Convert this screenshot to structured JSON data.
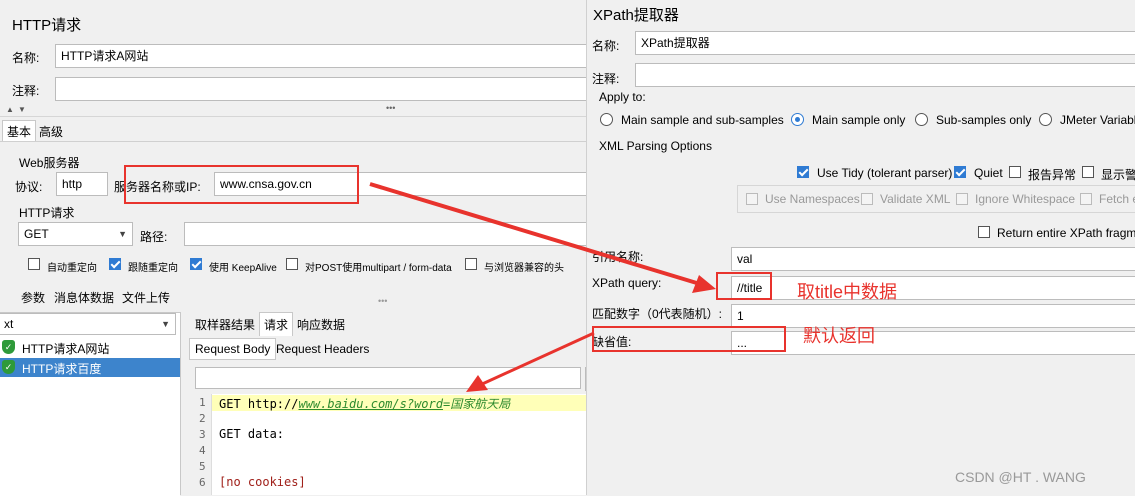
{
  "left": {
    "title": "HTTP请求",
    "name_label": "名称:",
    "name_value": "HTTP请求A网站",
    "comment_label": "注释:",
    "tabs": [
      "基本",
      "高级"
    ],
    "web_server_label": "Web服务器",
    "protocol_label": "协议:",
    "protocol_value": "http",
    "server_label": "服务器名称或IP:",
    "server_value": "www.cnsa.gov.cn",
    "http_request_label": "HTTP请求",
    "method_value": "GET",
    "path_label": "路径:",
    "options": [
      {
        "label": "自动重定向",
        "checked": false
      },
      {
        "label": "跟随重定向",
        "checked": true
      },
      {
        "label": "使用 KeepAlive",
        "checked": true
      },
      {
        "label": "对POST使用multipart / form-data",
        "checked": false
      },
      {
        "label": "与浏览器兼容的头",
        "checked": false
      }
    ],
    "sub_tabs": [
      "参数",
      "消息体数据",
      "文件上传"
    ]
  },
  "results": {
    "dropdown_value": "xt",
    "tree_items": [
      "HTTP请求A网站",
      "HTTP请求百度"
    ],
    "tabs": [
      "取样器结果",
      "请求",
      "响应数据"
    ],
    "sub_tabs": [
      "Request Body",
      "Request Headers"
    ],
    "lines": [
      {
        "no": "1",
        "text": "GET http://www.baidu.com/s?word=国家航天局"
      },
      {
        "no": "3",
        "text": "GET data:"
      },
      {
        "no": "6",
        "text": "[no cookies]"
      }
    ],
    "line_prefix": "GET http://",
    "line_url": "www.baidu.com/s?word",
    "line_suffix": "=国家航天局",
    "line_numbers": [
      "1",
      "2",
      "3",
      "4",
      "5",
      "6"
    ]
  },
  "xpath": {
    "title": "XPath提取器",
    "name_label": "名称:",
    "name_value": "XPath提取器",
    "comment_label": "注释:",
    "apply_to_label": "Apply to:",
    "apply_options": [
      {
        "label": "Main sample and sub-samples",
        "selected": false
      },
      {
        "label": "Main sample only",
        "selected": true
      },
      {
        "label": "Sub-samples only",
        "selected": false
      },
      {
        "label": "JMeter Variable",
        "selected": false
      }
    ],
    "xml_parsing_label": "XML Parsing Options",
    "parse_opts": [
      {
        "label": "Use Tidy (tolerant parser)",
        "checked": true
      },
      {
        "label": "Quiet",
        "checked": true
      },
      {
        "label": "报告异常",
        "checked": false
      },
      {
        "label": "显示警",
        "checked": false
      }
    ],
    "disabled_opts": [
      "Use Namespaces",
      "Validate XML",
      "Ignore Whitespace",
      "Fetch e"
    ],
    "return_entire_label": "Return entire XPath fragm",
    "ref_name_label": "引用名称:",
    "ref_name_value": "val",
    "query_label": "XPath query:",
    "query_value": "//title",
    "match_no_label": "匹配数字（0代表随机）:",
    "match_no_value": "1",
    "default_label": "缺省值:",
    "default_value": "..."
  },
  "annotations": {
    "query_note": "取title中数据",
    "default_note": "默认返回"
  },
  "watermark": "CSDN @HT . WANG",
  "colors": {
    "accent": "#2f7bd3",
    "annotation": "#e8332d",
    "highlight_line": "#ffffb8",
    "selected_row": "#3d84cc"
  }
}
